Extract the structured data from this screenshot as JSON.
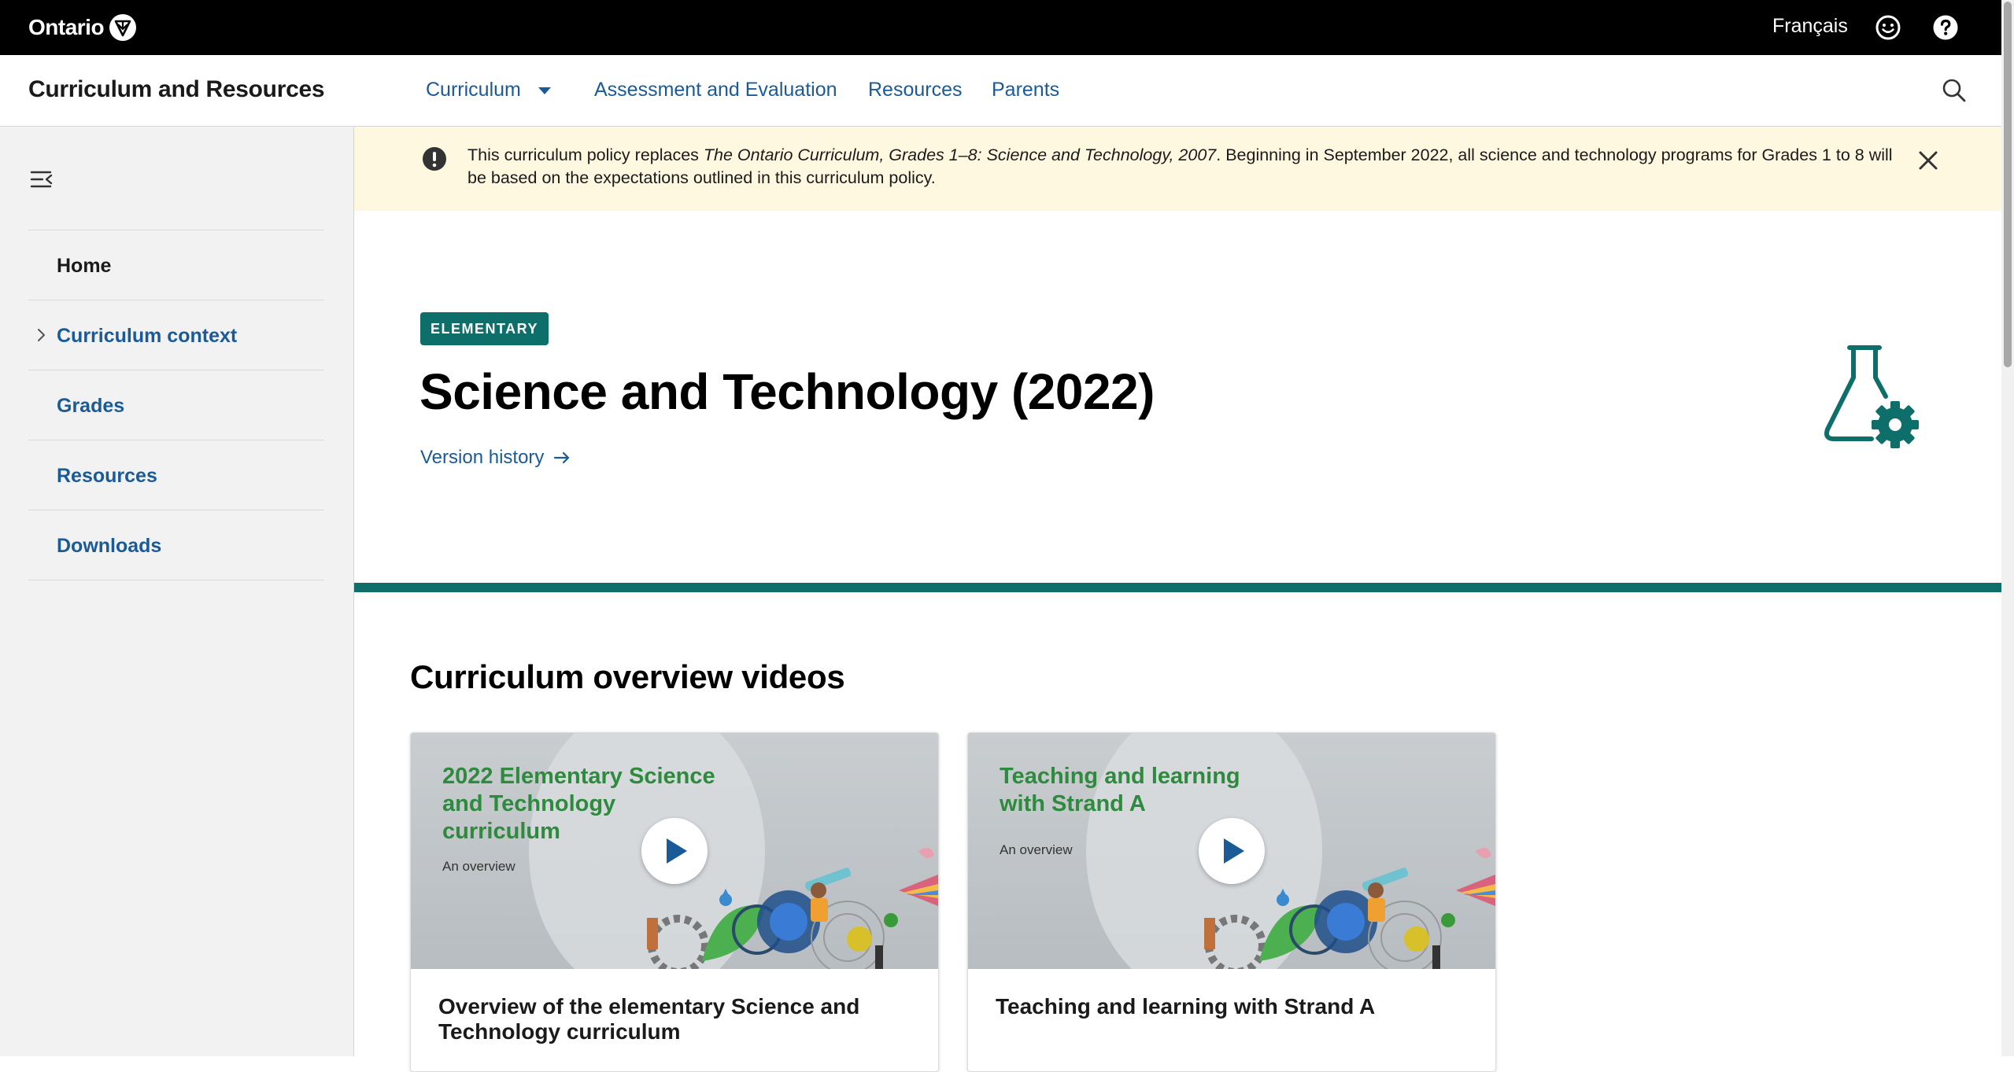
{
  "topbar": {
    "brand": "Ontario",
    "language_link": "Français",
    "icons": [
      "trillium-logo-icon",
      "smiley-feedback-icon",
      "help-question-icon"
    ]
  },
  "header": {
    "site_title": "Curriculum and Resources",
    "nav": {
      "curriculum": "Curriculum",
      "assessment": "Assessment and Evaluation",
      "resources": "Resources",
      "parents": "Parents"
    },
    "search_icon": "search-icon"
  },
  "sidebar": {
    "collapse_icon": "collapse-menu-icon",
    "items": [
      {
        "label": "Home",
        "active": true
      },
      {
        "label": "Curriculum context",
        "expandable": true
      },
      {
        "label": "Grades"
      },
      {
        "label": "Resources"
      },
      {
        "label": "Downloads"
      }
    ]
  },
  "alert": {
    "text_before": "This curriculum policy replaces ",
    "text_italic": "The Ontario Curriculum, Grades 1–8: Science and Technology, 2007",
    "text_after": ". Beginning in September 2022, all science and technology programs for Grades 1 to 8 will be based on the expectations outlined in this curriculum policy.",
    "bg_color": "#fff8e1"
  },
  "hero": {
    "badge": "ELEMENTARY",
    "title": "Science and Technology (2022)",
    "version_link": "Version history",
    "icon": "flask-gear-icon",
    "accent_color": "#0d6e6a"
  },
  "videos": {
    "section_title": "Curriculum overview videos",
    "cards": [
      {
        "thumb_title": "2022 Elementary Science and Technology curriculum",
        "thumb_subtitle": "An overview",
        "title": "Overview of the elementary Science and Technology curriculum"
      },
      {
        "thumb_title": "Teaching and learning with Strand A",
        "thumb_subtitle": "An overview",
        "title": "Teaching and learning with Strand A"
      }
    ]
  },
  "colors": {
    "link": "#1a5a96",
    "brand_bar": "#000000",
    "teal": "#0d6e6a",
    "thumb_green": "#2e8b3e"
  }
}
